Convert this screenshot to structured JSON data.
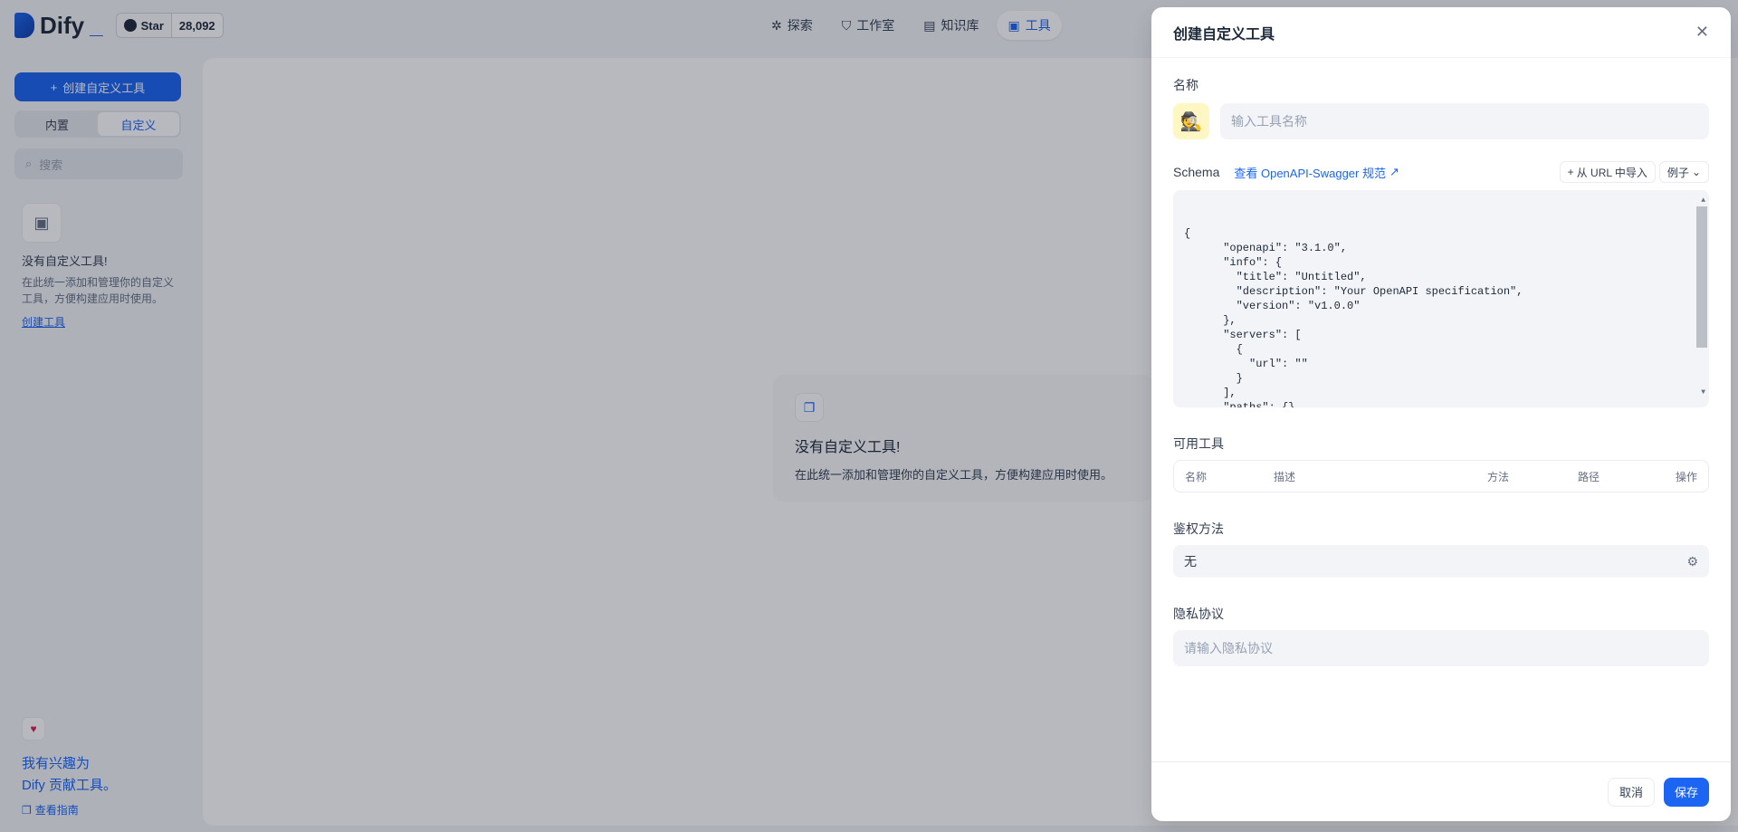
{
  "topbar": {
    "logo_text": "Dify",
    "logo_underscore": "_",
    "github_star_label": "Star",
    "github_star_count": "28,092",
    "nav": [
      {
        "label": "探索",
        "icon": "explore-icon"
      },
      {
        "label": "工作室",
        "icon": "studio-icon"
      },
      {
        "label": "知识库",
        "icon": "knowledge-icon"
      },
      {
        "label": "工具",
        "icon": "tools-icon"
      }
    ]
  },
  "sidebar": {
    "create_button": "创建自定义工具",
    "create_plus": "+",
    "segments": [
      "内置",
      "自定义"
    ],
    "search_placeholder": "搜索",
    "empty_title": "没有自定义工具!",
    "empty_desc": "在此统一添加和管理你的自定义工具，方便构建应用时使用。",
    "empty_link": "创建工具",
    "contrib_line1": "我有兴趣为",
    "contrib_line2": "Dify 贡献工具。",
    "contrib_link": "查看指南"
  },
  "main": {
    "empty_title": "没有自定义工具!",
    "empty_desc": "在此统一添加和管理你的自定义工具，方便构建应用时使用。"
  },
  "drawer": {
    "title": "创建自定义工具",
    "close_symbol": "✕",
    "name_label": "名称",
    "name_placeholder": "输入工具名称",
    "schema_label": "Schema",
    "schema_link": "查看 OpenAPI-Swagger 规范",
    "import_url_button": "从 URL 中导入",
    "import_plus": "+",
    "example_button": "例子",
    "schema_code": "{\n      \"openapi\": \"3.1.0\",\n      \"info\": {\n        \"title\": \"Untitled\",\n        \"description\": \"Your OpenAPI specification\",\n        \"version\": \"v1.0.0\"\n      },\n      \"servers\": [\n        {\n          \"url\": \"\"\n        }\n      ],\n      \"paths\": {},\n      \"components\": {\n        \"schemas\": {}",
    "available_tools_label": "可用工具",
    "table_headers": {
      "name": "名称",
      "desc": "描述",
      "method": "方法",
      "path": "路径",
      "op": "操作"
    },
    "auth_label": "鉴权方法",
    "auth_value": "无",
    "privacy_label": "隐私协议",
    "privacy_placeholder": "请输入隐私协议",
    "cancel_button": "取消",
    "save_button": "保存"
  },
  "colors": {
    "accent": "#1c64f2",
    "overlay": "rgba(16,24,40,0.3)"
  }
}
